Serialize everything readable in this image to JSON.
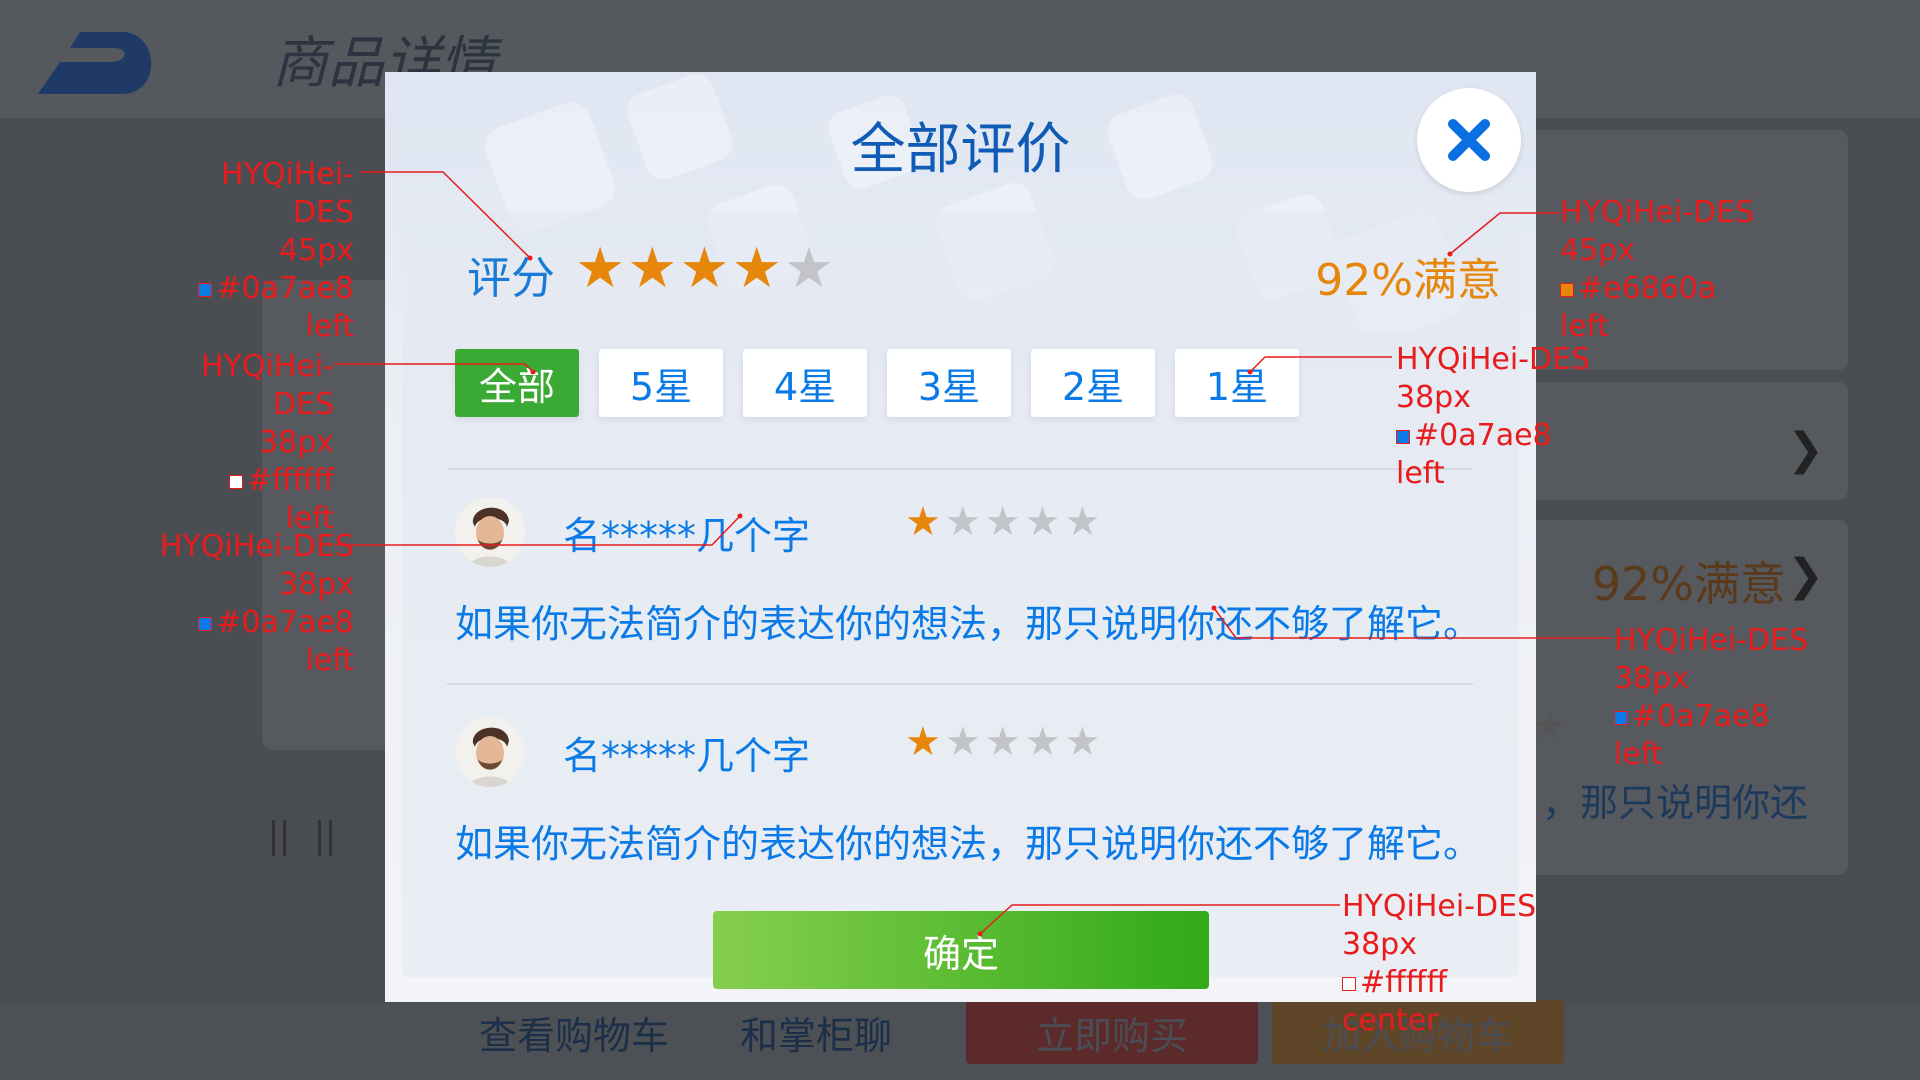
{
  "background": {
    "page_title": "商品详情",
    "satisfaction": "92%满意",
    "review_text_fragment": "，那只说明你还",
    "bottom_bar": {
      "view_cart": "查看购物车",
      "chat": "和掌柜聊",
      "buy_now": "立即购买",
      "add_to_cart": "加入购物车"
    }
  },
  "modal": {
    "title": "全部评价",
    "close_icon": "close-icon",
    "score_label": "评分",
    "score_rating": 4,
    "score_max": 5,
    "satisfaction": "92%满意",
    "filters": [
      "全部",
      "5星",
      "4星",
      "3星",
      "2星",
      "1星"
    ],
    "active_filter": "全部",
    "reviews": [
      {
        "reviewer": "名*****几个字",
        "rating": 1,
        "text": "如果你无法简介的表达你的想法，那只说明你还不够了解它。"
      },
      {
        "reviewer": "名*****几个字",
        "rating": 1,
        "text": "如果你无法简介的表达你的想法，那只说明你还不够了解它。"
      }
    ],
    "confirm": "确定"
  },
  "annotations": {
    "score_label": [
      "HYQiHei-DES",
      "45px",
      "#0a7ae8",
      "left"
    ],
    "satisfaction": [
      "HYQiHei-DES",
      "45px",
      "#e6860a",
      "left"
    ],
    "active_filter": [
      "HYQiHei-DES",
      "38px",
      "#ffffff",
      "left"
    ],
    "filter": [
      "HYQiHei-DES",
      "38px",
      "#0a7ae8",
      "left"
    ],
    "reviewer": [
      "HYQiHei-DES",
      "38px",
      "#0a7ae8",
      "left"
    ],
    "review_text": [
      "HYQiHei-DES",
      "38px",
      "#0a7ae8",
      "left"
    ],
    "confirm": [
      "HYQiHei-DES",
      "38px",
      "#ffffff",
      "center"
    ]
  },
  "colors": {
    "primary_blue": "#0a7ae8",
    "title_blue": "#0f5bb5",
    "orange": "#e6860a",
    "green": "#3aaa35",
    "annotation_red": "#e81c1c"
  }
}
